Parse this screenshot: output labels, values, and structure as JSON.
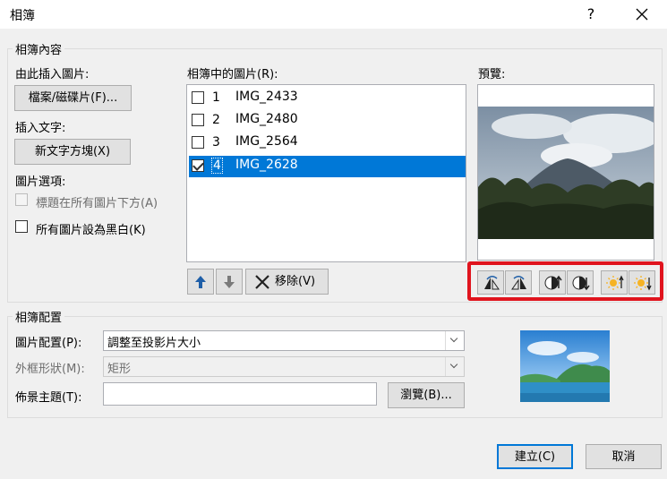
{
  "window": {
    "title": "相簿",
    "help": "?",
    "close": "✕"
  },
  "album_content": {
    "group_label": "相簿內容",
    "insert_from_label": "由此插入圖片:",
    "file_disk_button": "檔案/磁碟片(F)...",
    "insert_text_label": "插入文字:",
    "new_textbox_button": "新文字方塊(X)",
    "picture_options_label": "圖片選項:",
    "captions_below": "標題在所有圖片下方(A)",
    "all_black_white": "所有圖片設為黑白(K)",
    "pictures_in_album_label": "相簿中的圖片(R):",
    "pictures": [
      {
        "num": "1",
        "name": "IMG_2433",
        "checked": false,
        "selected": false
      },
      {
        "num": "2",
        "name": "IMG_2480",
        "checked": false,
        "selected": false
      },
      {
        "num": "3",
        "name": "IMG_2564",
        "checked": false,
        "selected": false
      },
      {
        "num": "4",
        "name": "IMG_2628",
        "checked": true,
        "selected": true
      }
    ],
    "remove_button": "移除(V)",
    "preview_label": "預覽:"
  },
  "album_layout": {
    "group_label": "相簿配置",
    "picture_layout_label": "圖片配置(P):",
    "picture_layout_value": "調整至投影片大小",
    "frame_shape_label": "外框形狀(M):",
    "frame_shape_value": "矩形",
    "theme_label": "佈景主題(T):",
    "theme_value": "",
    "browse_button": "瀏覽(B)..."
  },
  "footer": {
    "create_button": "建立(C)",
    "cancel_button": "取消"
  },
  "colors": {
    "selection": "#0078d7",
    "highlight_box": "#e0141e"
  }
}
